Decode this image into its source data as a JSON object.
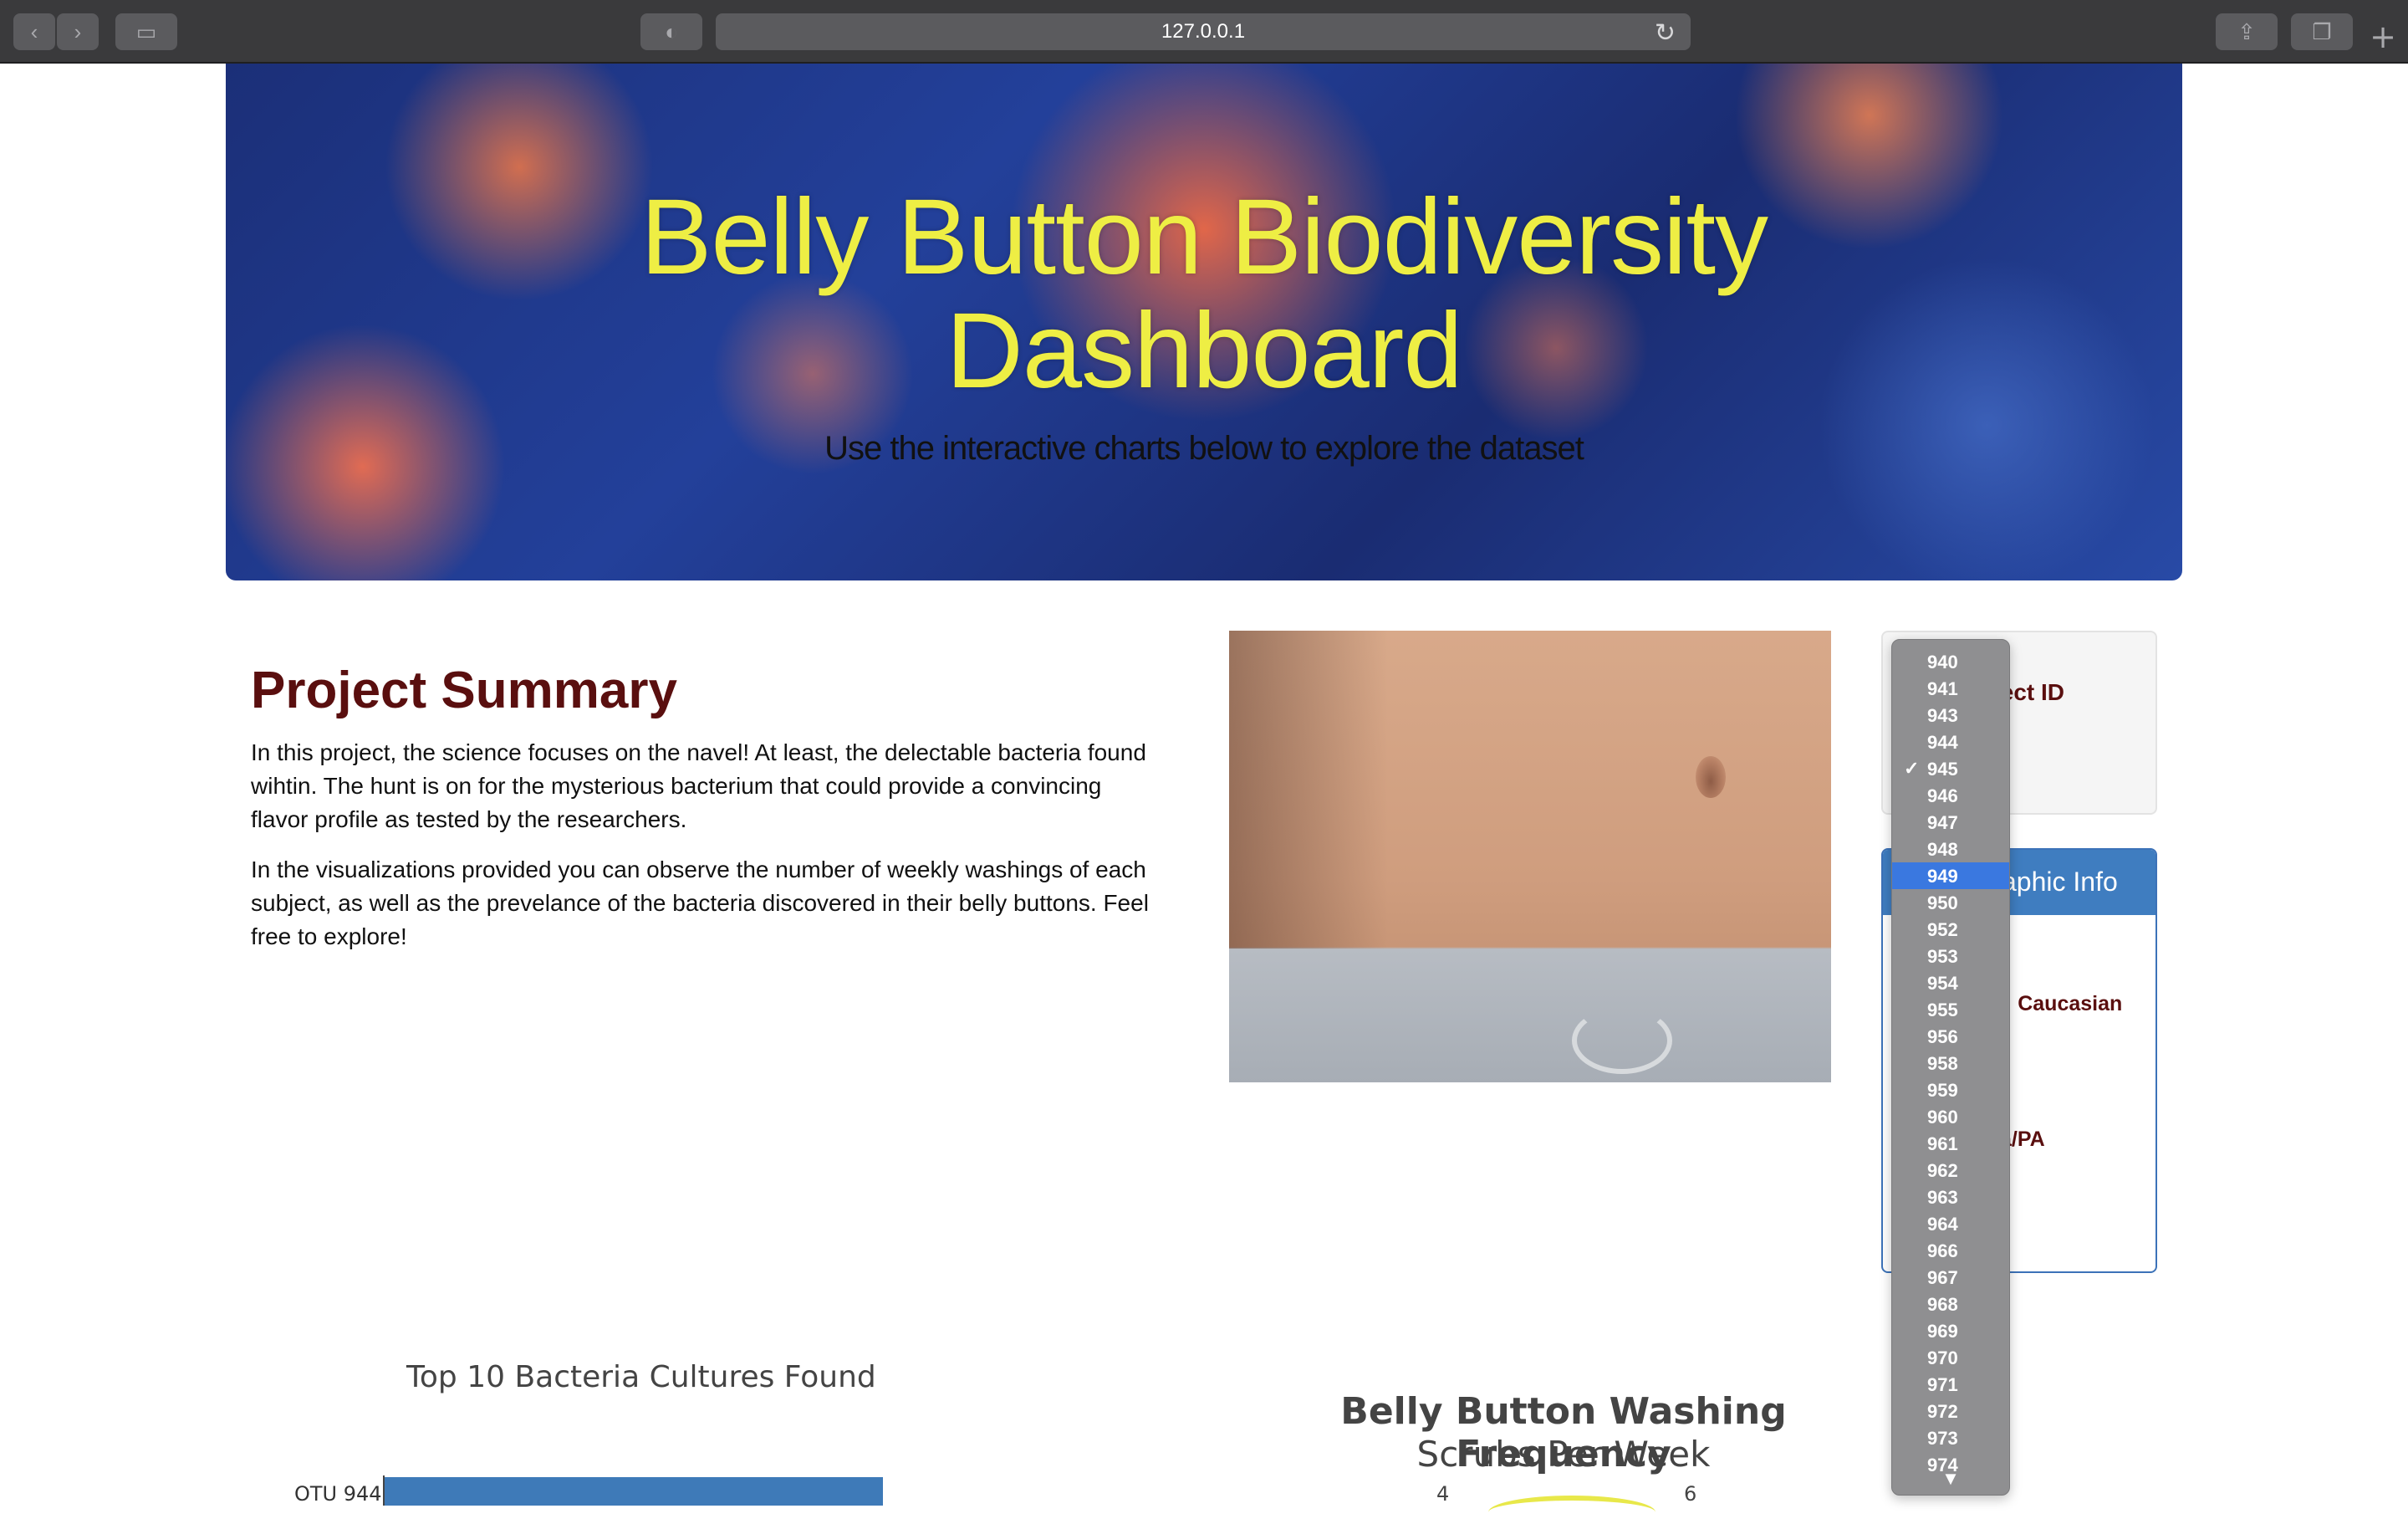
{
  "browser": {
    "url": "127.0.0.1"
  },
  "hero": {
    "title_line1": "Belly Button Biodiversity",
    "title_line2": "Dashboard",
    "subtitle": "Use the interactive charts below to explore the dataset"
  },
  "summary": {
    "title": "Project Summary",
    "para1_line1": "In this project, the science focuses on the navel! At least, the delectable bacteria found",
    "para1_line2": "wihtin. The hunt is on for the mysterious bacterium that could provide a convincing",
    "para1_line3": "flavor profile as tested by the researchers.",
    "para2_line1": "In the visualizations provided you can observe the number of weekly washings of each",
    "para2_line2": "subject, as well as the prevelance of the bacteria discovered in their belly buttons. Feel",
    "para2_line3": "free to explore!"
  },
  "subject_select": {
    "label_visible": "ject ID",
    "selected": "945",
    "highlighted": "949",
    "options_visible": [
      "940",
      "941",
      "943",
      "944",
      "945",
      "946",
      "947",
      "948",
      "949",
      "950",
      "952",
      "953",
      "954",
      "955",
      "956",
      "958",
      "959",
      "960",
      "961",
      "962",
      "963",
      "964",
      "966",
      "967",
      "968",
      "969",
      "970",
      "971",
      "972",
      "973",
      "974"
    ]
  },
  "demographic": {
    "header_visible": "aphic Info",
    "line_ethnicity": "': Caucasian",
    "line_gender": ":",
    "line_location_key": ":",
    "line_location_val": "a/PA"
  },
  "bar_chart": {
    "title": "Top 10 Bacteria Cultures Found",
    "first_label": "OTU 944"
  },
  "gauge": {
    "title": "Belly Button Washing Frequency",
    "subtitle": "Scrubs Per Week",
    "tick_left": "4",
    "tick_right": "6"
  },
  "chart_data": {
    "type": "bar",
    "title": "Top 10 Bacteria Cultures Found",
    "categories": [
      "OTU 944"
    ],
    "values": [
      null
    ],
    "orientation": "horizontal"
  },
  "colors": {
    "hero_title": "#eeee44",
    "summary_title": "#5a0f0f",
    "panel_header": "#3f7dc0",
    "dropdown_bg": "#8f8f91",
    "dropdown_highlight": "#3a78e0",
    "bar": "#3e7ab8"
  }
}
